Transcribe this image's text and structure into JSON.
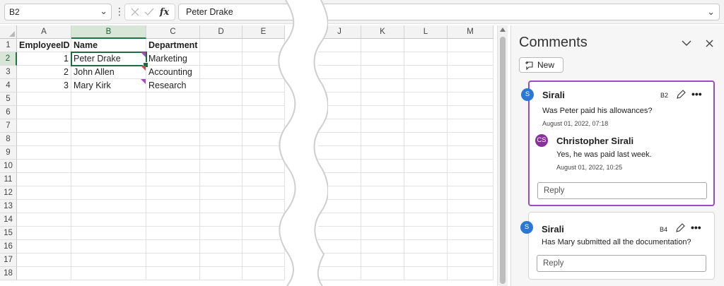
{
  "formula_bar": {
    "name_box": "B2",
    "formula": "Peter Drake",
    "fx_label": "fx"
  },
  "grid": {
    "columns": [
      "A",
      "B",
      "C",
      "D",
      "E",
      "J",
      "K",
      "L",
      "M"
    ],
    "rows": [
      "1",
      "2",
      "3",
      "4",
      "5",
      "6",
      "7",
      "8",
      "9",
      "10",
      "11",
      "12",
      "13",
      "14",
      "15",
      "16",
      "17",
      "18"
    ],
    "headers": [
      "EmployeeID",
      "Name",
      "Department"
    ],
    "data": [
      {
        "id": "1",
        "name": "Peter Drake",
        "dept": "Marketing"
      },
      {
        "id": "2",
        "name": "John Allen",
        "dept": "Accounting"
      },
      {
        "id": "3",
        "name": "Mary Kirk",
        "dept": "Research"
      }
    ],
    "selected_cell": "B2"
  },
  "comments_pane": {
    "title": "Comments",
    "new_label": "New",
    "threads": [
      {
        "cell": "B2",
        "author": "Sirali",
        "initials": "S",
        "text": "Was Peter paid his allowances?",
        "date": "August 01, 2022, 07:18",
        "reply": {
          "author": "Christopher Sirali",
          "initials": "CS",
          "text": "Yes, he was paid last week.",
          "date": "August 01, 2022, 10:25"
        },
        "reply_placeholder": "Reply"
      },
      {
        "cell": "B4",
        "author": "Sirali",
        "initials": "S",
        "text": "Has Mary submitted all the documentation?",
        "reply_placeholder": "Reply"
      }
    ]
  },
  "colors": {
    "excel_green": "#1e6b41",
    "comment_purple": "#9b4cc4",
    "avatar_blue": "#2a78d4",
    "avatar_purple": "#8a2f9e"
  }
}
